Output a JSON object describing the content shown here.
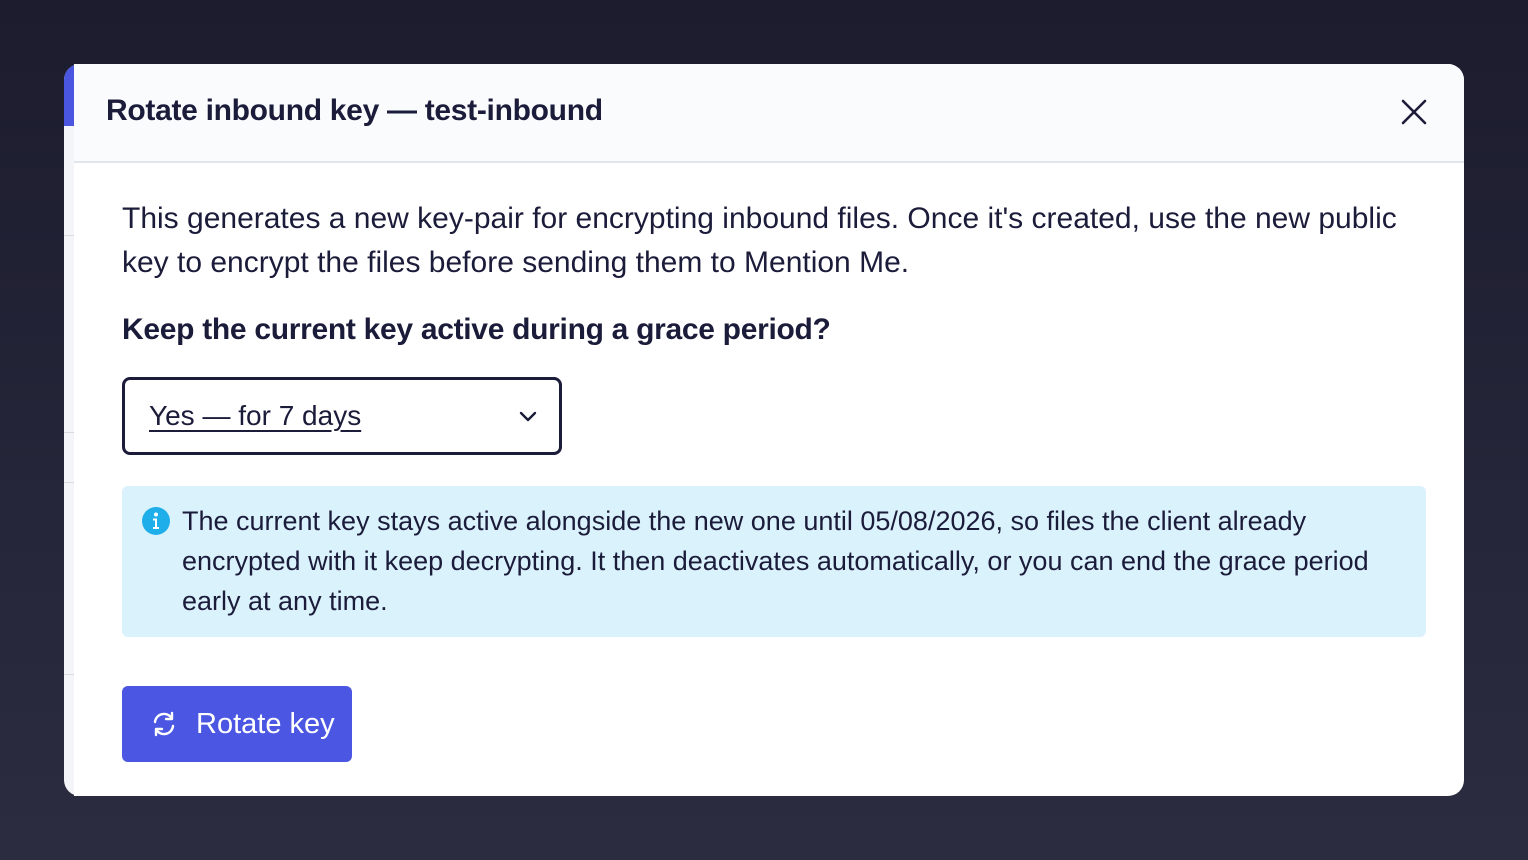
{
  "dialog": {
    "title": "Rotate inbound key — test-inbound",
    "close_icon": "close-icon"
  },
  "body": {
    "description": "This generates a new key-pair for encrypting inbound files. Once it's created, use the new public key to encrypt the files before sending them to Mention Me.",
    "question": "Keep the current key active during a grace period?",
    "grace_select": {
      "selected": "Yes — for 7 days",
      "icon": "chevron-down-icon"
    },
    "info": {
      "icon": "info-icon",
      "text": "The current key stays active alongside the new one until 05/08/2026, so files the client already encrypted with it keep decrypting. It then deactivates automatically, or you can end the grace period early at any time."
    },
    "rotate_button": {
      "label": "Rotate key",
      "icon": "refresh-icon"
    }
  },
  "colors": {
    "primary": "#4b57e3",
    "info_background": "#daf2fc",
    "info_icon": "#1eaeea",
    "text": "#1b1b3a",
    "backdrop": "#1c1c2e"
  }
}
